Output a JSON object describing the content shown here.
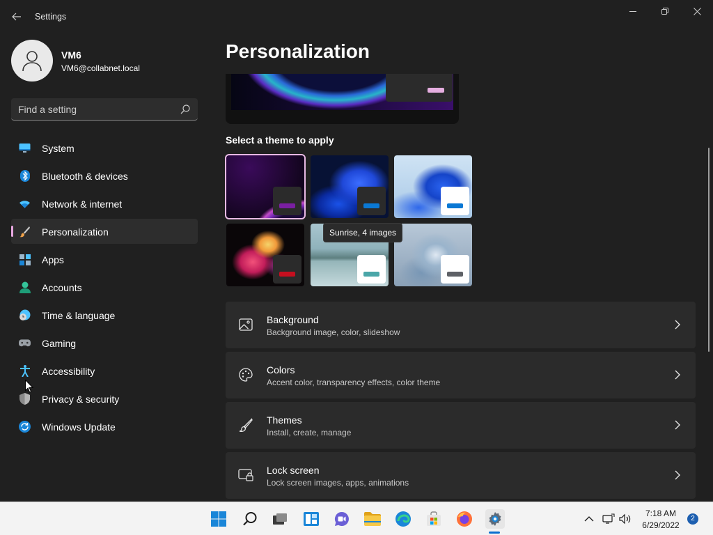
{
  "window": {
    "title": "Settings",
    "controls": [
      "minimize",
      "restore",
      "close"
    ]
  },
  "user": {
    "name": "VM6",
    "email": "VM6@collabnet.local"
  },
  "search": {
    "placeholder": "Find a setting"
  },
  "sidebar": {
    "items": [
      {
        "label": "System",
        "icon": "monitor-icon",
        "selected": false
      },
      {
        "label": "Bluetooth & devices",
        "icon": "bluetooth-icon",
        "selected": false
      },
      {
        "label": "Network & internet",
        "icon": "wifi-icon",
        "selected": false
      },
      {
        "label": "Personalization",
        "icon": "brush-icon",
        "selected": true
      },
      {
        "label": "Apps",
        "icon": "apps-icon",
        "selected": false
      },
      {
        "label": "Accounts",
        "icon": "person-icon",
        "selected": false
      },
      {
        "label": "Time & language",
        "icon": "globe-clock-icon",
        "selected": false
      },
      {
        "label": "Gaming",
        "icon": "gamepad-icon",
        "selected": false
      },
      {
        "label": "Accessibility",
        "icon": "accessibility-icon",
        "selected": false
      },
      {
        "label": "Privacy & security",
        "icon": "shield-icon",
        "selected": false
      },
      {
        "label": "Windows Update",
        "icon": "update-icon",
        "selected": false
      }
    ]
  },
  "main": {
    "title": "Personalization",
    "theme_section_title": "Select a theme to apply",
    "tooltip": "Sunrise, 4 images",
    "themes": [
      {
        "name": "purple-glow-theme",
        "accent": "#7a1fa2",
        "panel": "#2b2b2b",
        "selected": true
      },
      {
        "name": "dark-bloom-theme",
        "accent": "#0a78d4",
        "panel": "#2b2b2b",
        "selected": false
      },
      {
        "name": "light-bloom-theme",
        "accent": "#0a78d4",
        "panel": "#ffffff",
        "selected": false
      },
      {
        "name": "flower-theme",
        "accent": "#c50f1f",
        "panel": "#2b2b2b",
        "selected": false
      },
      {
        "name": "sunrise-theme",
        "accent": "#4aa6a8",
        "panel": "#ffffff",
        "selected": false
      },
      {
        "name": "flow-theme",
        "accent": "#5e6166",
        "panel": "#ffffff",
        "selected": false
      }
    ],
    "cards": [
      {
        "title": "Background",
        "subtitle": "Background image, color, slideshow",
        "icon": "image-icon"
      },
      {
        "title": "Colors",
        "subtitle": "Accent color, transparency effects, color theme",
        "icon": "palette-icon"
      },
      {
        "title": "Themes",
        "subtitle": "Install, create, manage",
        "icon": "brush-icon"
      },
      {
        "title": "Lock screen",
        "subtitle": "Lock screen images, apps, animations",
        "icon": "lock-screen-icon"
      }
    ]
  },
  "taskbar": {
    "apps": [
      "start-icon",
      "search-icon",
      "task-view-icon",
      "widgets-icon",
      "chat-icon",
      "file-explorer-icon",
      "edge-icon",
      "store-icon",
      "firefox-icon",
      "settings-icon"
    ],
    "active_app": "settings-icon",
    "time": "7:18 AM",
    "date": "6/29/2022",
    "notifications": "2"
  },
  "colors": {
    "accent": "#e7a7e0",
    "background": "#202020",
    "card": "#2b2b2b",
    "taskbar": "#f3f3f3"
  }
}
